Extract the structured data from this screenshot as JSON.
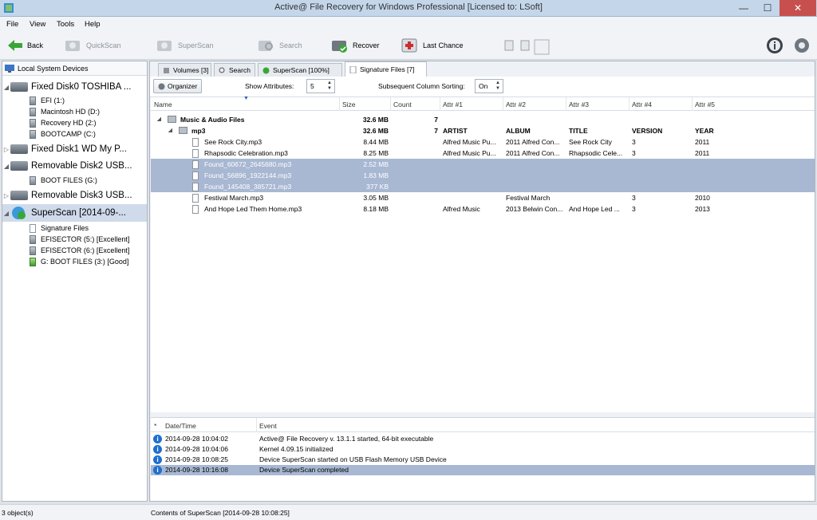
{
  "window": {
    "title": "Active@ File Recovery for Windows Professional [Licensed to: LSoft]",
    "minimize": "—",
    "maximize": "☐",
    "close": "✕"
  },
  "menu": [
    "File",
    "View",
    "Tools",
    "Help"
  ],
  "toolbar": {
    "back": "Back",
    "quickscan": "QuickScan",
    "superscan": "SuperScan",
    "search": "Search",
    "recover": "Recover",
    "last_chance": "Last Chance"
  },
  "left": {
    "header": "Local System Devices",
    "items": [
      {
        "label": "Fixed Disk0 TOSHIBA ..."
      },
      {
        "label": "EFI (1:)"
      },
      {
        "label": "Macintosh HD (D:)"
      },
      {
        "label": "Recovery HD (2:)"
      },
      {
        "label": "BOOTCAMP (C:)"
      },
      {
        "label": "Fixed Disk1 WD My P..."
      },
      {
        "label": "Removable Disk2 USB..."
      },
      {
        "label": "BOOT FILES (G:)"
      },
      {
        "label": "Removable Disk3 USB..."
      },
      {
        "label": "SuperScan [2014-09-..."
      },
      {
        "label": "Signature Files"
      },
      {
        "label": "EFISECTOR (5:) [Excellent]"
      },
      {
        "label": "EFISECTOR (6:) [Excellent]"
      },
      {
        "label": "G: BOOT FILES (3:) [Good]"
      }
    ]
  },
  "tabs": [
    {
      "label": "Volumes [3]"
    },
    {
      "label": "Search"
    },
    {
      "label": "SuperScan [100%]"
    },
    {
      "label": "Signature Files [7]"
    }
  ],
  "options": {
    "organizer": "Organizer",
    "show_attributes_label": "Show Attributes:",
    "show_attributes_value": "5",
    "sorting_label": "Subsequent Column Sorting:",
    "sorting_value": "On"
  },
  "grid": {
    "columns": [
      "Name",
      "Size",
      "Count",
      "Attr #1",
      "Attr #2",
      "Attr #3",
      "Attr #4",
      "Attr #5"
    ],
    "rows": [
      {
        "name": "Music & Audio Files",
        "size": "32.6 MB",
        "count": "7",
        "a1": "",
        "a2": "",
        "a3": "",
        "a4": "",
        "a5": ""
      },
      {
        "name": "mp3",
        "size": "32.6 MB",
        "count": "7",
        "a1": "ARTIST",
        "a2": "ALBUM",
        "a3": "TITLE",
        "a4": "VERSION",
        "a5": "YEAR"
      },
      {
        "name": "See Rock City.mp3",
        "size": "8.44 MB",
        "count": "",
        "a1": "Alfred Music Pu...",
        "a2": "2011 Alfred Con...",
        "a3": "See Rock City",
        "a4": "3",
        "a5": "2011"
      },
      {
        "name": "Rhapsodic Celebration.mp3",
        "size": "8.25 MB",
        "count": "",
        "a1": "Alfred Music Pu...",
        "a2": "2011 Alfred Con...",
        "a3": "Rhapsodic Cele...",
        "a4": "3",
        "a5": "2011"
      },
      {
        "name": "Found_60672_2645680.mp3",
        "size": "2.52 MB",
        "count": "",
        "a1": "",
        "a2": "",
        "a3": "",
        "a4": "",
        "a5": ""
      },
      {
        "name": "Found_56896_1922144.mp3",
        "size": "1.83 MB",
        "count": "",
        "a1": "",
        "a2": "",
        "a3": "",
        "a4": "",
        "a5": ""
      },
      {
        "name": "Found_145408_385721.mp3",
        "size": "377 KB",
        "count": "",
        "a1": "",
        "a2": "",
        "a3": "",
        "a4": "",
        "a5": ""
      },
      {
        "name": "Festival March.mp3",
        "size": "3.05 MB",
        "count": "",
        "a1": "",
        "a2": "Festival March",
        "a3": "",
        "a4": "3",
        "a5": "2010"
      },
      {
        "name": "And Hope Led Them Home.mp3",
        "size": "8.18 MB",
        "count": "",
        "a1": "Alfred Music",
        "a2": "2013 Belwin Con...",
        "a3": "And Hope Led ...",
        "a4": "3",
        "a5": "2013"
      }
    ]
  },
  "log": {
    "col_star": "*",
    "col_date": "Date/Time",
    "col_event": "Event",
    "rows": [
      {
        "date": "2014-09-28 10:04:02",
        "event": "Active@ File Recovery v. 13.1.1 started, 64-bit executable"
      },
      {
        "date": "2014-09-28 10:04:06",
        "event": "Kernel 4.09.15 initialized"
      },
      {
        "date": "2014-09-28 10:08:25",
        "event": "Device SuperScan started on USB Flash Memory USB Device"
      },
      {
        "date": "2014-09-28 10:16:08",
        "event": "Device SuperScan completed"
      }
    ]
  },
  "status": {
    "left": "3 object(s)",
    "right": "Contents of SuperScan [2014-09-28 10:08:25]"
  }
}
